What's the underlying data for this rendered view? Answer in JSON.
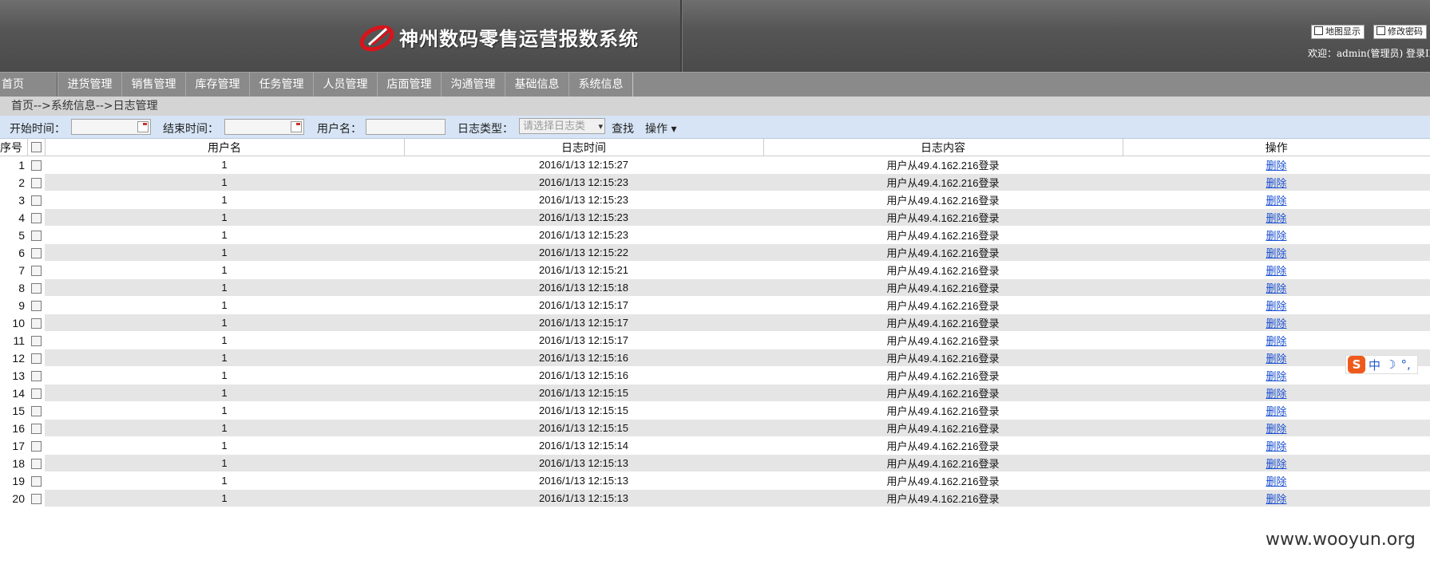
{
  "header": {
    "title": "神州数码零售运营报数系统",
    "map_button": "地图显示",
    "password_button": "修改密码",
    "welcome": "欢迎：admin(管理员) 登录IP:"
  },
  "nav": {
    "items": [
      "首页",
      "进货管理",
      "销售管理",
      "库存管理",
      "任务管理",
      "人员管理",
      "店面管理",
      "沟通管理",
      "基础信息",
      "系统信息"
    ]
  },
  "breadcrumb": "首页-->系统信息-->日志管理",
  "filter": {
    "start_label": "开始时间：",
    "end_label": "结束时间：",
    "user_label": "用户名：",
    "type_label": "日志类型：",
    "type_placeholder": "请选择日志类",
    "search_label": "查找",
    "action_label": "操作 ▾"
  },
  "table": {
    "columns": [
      "序号",
      "用户名",
      "日志时间",
      "日志内容",
      "操作"
    ],
    "rows": [
      {
        "idx": "1",
        "user": "1",
        "time": "2016/1/13 12:15:27",
        "content": "用户从49.4.162.216登录",
        "action": "删除"
      },
      {
        "idx": "2",
        "user": "1",
        "time": "2016/1/13 12:15:23",
        "content": "用户从49.4.162.216登录",
        "action": "删除"
      },
      {
        "idx": "3",
        "user": "1",
        "time": "2016/1/13 12:15:23",
        "content": "用户从49.4.162.216登录",
        "action": "删除"
      },
      {
        "idx": "4",
        "user": "1",
        "time": "2016/1/13 12:15:23",
        "content": "用户从49.4.162.216登录",
        "action": "删除"
      },
      {
        "idx": "5",
        "user": "1",
        "time": "2016/1/13 12:15:23",
        "content": "用户从49.4.162.216登录",
        "action": "删除"
      },
      {
        "idx": "6",
        "user": "1",
        "time": "2016/1/13 12:15:22",
        "content": "用户从49.4.162.216登录",
        "action": "删除"
      },
      {
        "idx": "7",
        "user": "1",
        "time": "2016/1/13 12:15:21",
        "content": "用户从49.4.162.216登录",
        "action": "删除"
      },
      {
        "idx": "8",
        "user": "1",
        "time": "2016/1/13 12:15:18",
        "content": "用户从49.4.162.216登录",
        "action": "删除"
      },
      {
        "idx": "9",
        "user": "1",
        "time": "2016/1/13 12:15:17",
        "content": "用户从49.4.162.216登录",
        "action": "删除"
      },
      {
        "idx": "10",
        "user": "1",
        "time": "2016/1/13 12:15:17",
        "content": "用户从49.4.162.216登录",
        "action": "删除"
      },
      {
        "idx": "11",
        "user": "1",
        "time": "2016/1/13 12:15:17",
        "content": "用户从49.4.162.216登录",
        "action": "删除"
      },
      {
        "idx": "12",
        "user": "1",
        "time": "2016/1/13 12:15:16",
        "content": "用户从49.4.162.216登录",
        "action": "删除"
      },
      {
        "idx": "13",
        "user": "1",
        "time": "2016/1/13 12:15:16",
        "content": "用户从49.4.162.216登录",
        "action": "删除"
      },
      {
        "idx": "14",
        "user": "1",
        "time": "2016/1/13 12:15:15",
        "content": "用户从49.4.162.216登录",
        "action": "删除"
      },
      {
        "idx": "15",
        "user": "1",
        "time": "2016/1/13 12:15:15",
        "content": "用户从49.4.162.216登录",
        "action": "删除"
      },
      {
        "idx": "16",
        "user": "1",
        "time": "2016/1/13 12:15:15",
        "content": "用户从49.4.162.216登录",
        "action": "删除"
      },
      {
        "idx": "17",
        "user": "1",
        "time": "2016/1/13 12:15:14",
        "content": "用户从49.4.162.216登录",
        "action": "删除"
      },
      {
        "idx": "18",
        "user": "1",
        "time": "2016/1/13 12:15:13",
        "content": "用户从49.4.162.216登录",
        "action": "删除"
      },
      {
        "idx": "19",
        "user": "1",
        "time": "2016/1/13 12:15:13",
        "content": "用户从49.4.162.216登录",
        "action": "删除"
      },
      {
        "idx": "20",
        "user": "1",
        "time": "2016/1/13 12:15:13",
        "content": "用户从49.4.162.216登录",
        "action": "删除"
      }
    ]
  },
  "ime": {
    "logo": "S",
    "lang": "中",
    "moon": "☽",
    "punct": "°,"
  },
  "watermark": "www.wooyun.org",
  "colors": {
    "header": "#565656",
    "nav": "#8a8a8a",
    "filter_bar": "#d6e4f5",
    "link": "#1a4fd0",
    "alt_row": "#e5e5e5"
  }
}
